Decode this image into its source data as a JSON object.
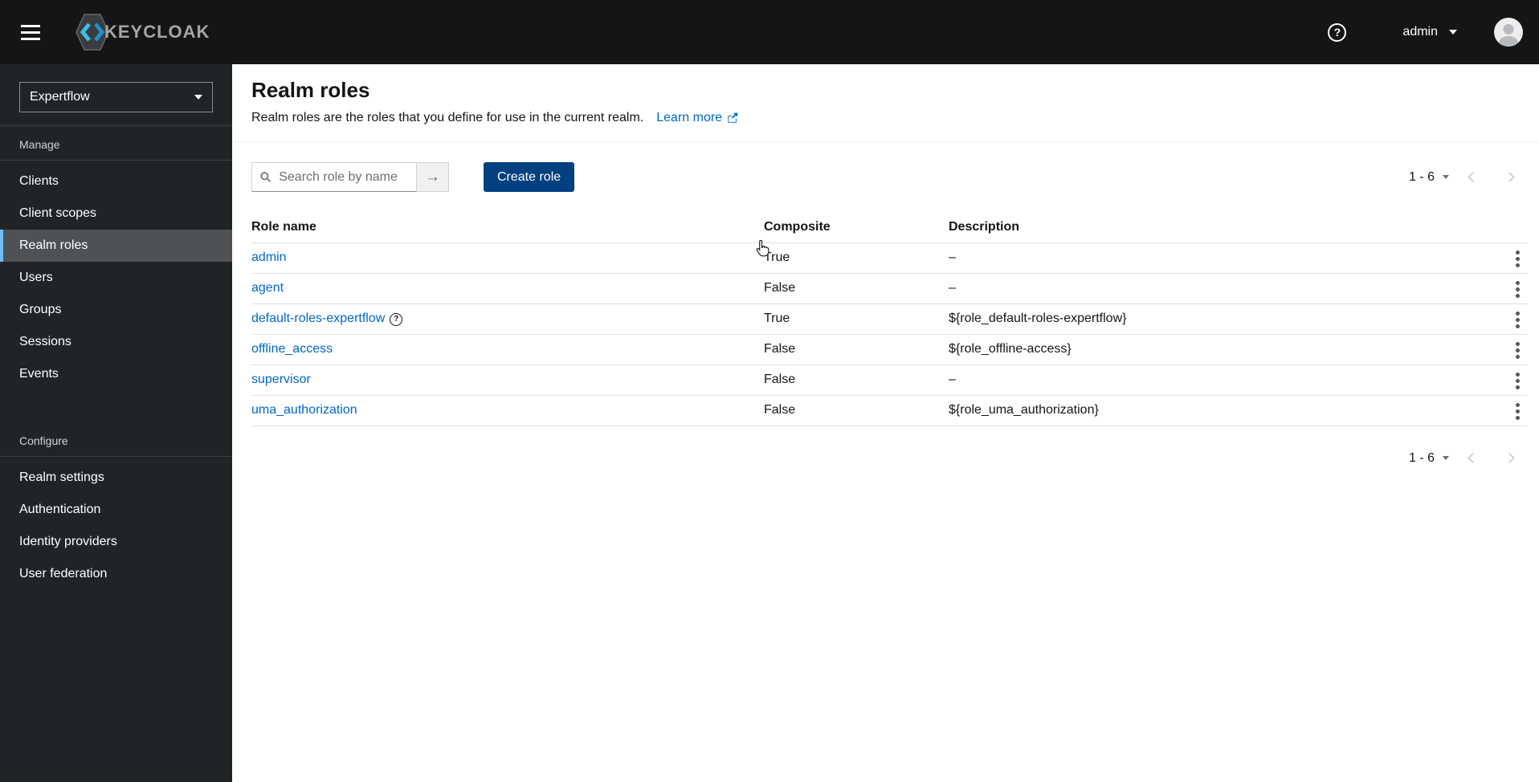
{
  "topbar": {
    "brand": "KEYCLOAK",
    "user": "admin"
  },
  "sidebar": {
    "realm": "Expertflow",
    "sections": [
      {
        "label": "Manage",
        "items": [
          {
            "label": "Clients"
          },
          {
            "label": "Client scopes"
          },
          {
            "label": "Realm roles",
            "selected": true
          },
          {
            "label": "Users"
          },
          {
            "label": "Groups"
          },
          {
            "label": "Sessions"
          },
          {
            "label": "Events"
          }
        ]
      },
      {
        "label": "Configure",
        "items": [
          {
            "label": "Realm settings"
          },
          {
            "label": "Authentication"
          },
          {
            "label": "Identity providers"
          },
          {
            "label": "User federation"
          }
        ]
      }
    ]
  },
  "page": {
    "title": "Realm roles",
    "subtitle": "Realm roles are the roles that you define for use in the current realm.",
    "learn_more_label": "Learn more"
  },
  "toolbar": {
    "search_placeholder": "Search role by name",
    "create_button_label": "Create role",
    "pagination_range": "1 - 6"
  },
  "table": {
    "columns": [
      "Role name",
      "Composite",
      "Description"
    ],
    "rows": [
      {
        "name": "admin",
        "composite": "True",
        "description": "–"
      },
      {
        "name": "agent",
        "composite": "False",
        "description": "–"
      },
      {
        "name": "default-roles-expertflow",
        "composite": "True",
        "description": "${role_default-roles-expertflow}",
        "help": true
      },
      {
        "name": "offline_access",
        "composite": "False",
        "description": "${role_offline-access}"
      },
      {
        "name": "supervisor",
        "composite": "False",
        "description": "–"
      },
      {
        "name": "uma_authorization",
        "composite": "False",
        "description": "${role_uma_authorization}"
      }
    ]
  },
  "footer": {
    "pagination_range": "1 - 6"
  },
  "icons": {
    "question_mark": "?",
    "arrow_right": "→"
  },
  "colors": {
    "topbar_bg": "#151515",
    "sidebar_bg": "#212427",
    "nav_selected_bg": "#4f5255",
    "nav_selected_indicator": "#73bcf7",
    "link": "#0066cc",
    "primary_button": "#004080"
  }
}
